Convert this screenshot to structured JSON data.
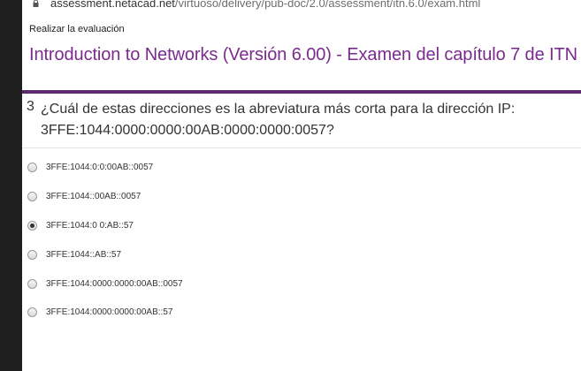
{
  "browser": {
    "url_host": "assessment.netacad.net",
    "url_path": "/virtuoso/delivery/pub-doc/2.0/assessment/itn.6.0/exam.html"
  },
  "header": {
    "tab_label": "Realizar la evaluación",
    "title": "Introduction to Networks (Versión 6.00) - Examen del capítulo 7 de ITN"
  },
  "colors": {
    "title": "#7b2a8e",
    "rule": "#5a2a6b"
  },
  "question": {
    "number": "3",
    "text_line1": "¿Cuál de estas direcciones es la abreviatura más corta para la dirección IP:",
    "text_line2": "3FFE:1044:0000:0000:00AB:0000:0000:0057?",
    "selected_index": 2,
    "options": [
      "3FFE:1044:0:0:00AB::0057",
      "3FFE:1044::00AB::0057",
      "3FFE:1044:0 0:AB::57",
      "3FFE:1044::AB::57",
      "3FFE:1044:0000:0000:00AB::0057",
      "3FFE:1044:0000:0000:00AB::57"
    ]
  }
}
